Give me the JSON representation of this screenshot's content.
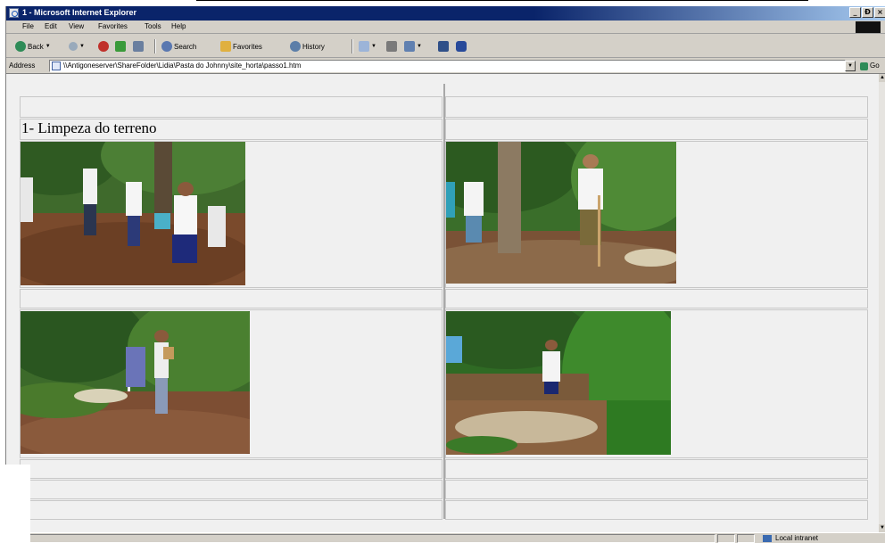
{
  "window": {
    "title": "1 - Microsoft Internet Explorer",
    "controls": [
      "_",
      "Ɖ",
      "×"
    ]
  },
  "menu": {
    "file": "File",
    "edit": "Edit",
    "view": "View",
    "favorites": "Favorites",
    "tools": "Tools",
    "help": "Help"
  },
  "toolbar": {
    "back": "Back",
    "search": "Search",
    "favorites": "Favorites",
    "history": "History"
  },
  "address": {
    "label": "Address",
    "url": "\\\\Antigoneserver\\ShareFolder\\Lidia\\Pasta do Johnny\\site_horta\\passo1.htm",
    "go": "Go"
  },
  "page": {
    "heading": "1- Limpeza do terreno",
    "photos": [
      {
        "description": "children clearing ground with rakes under trees"
      },
      {
        "description": "child with rake next to tree trunk"
      },
      {
        "description": "child raking soil beside bushes"
      },
      {
        "description": "child in shade of green trees"
      }
    ]
  },
  "status": {
    "zone": "Local intranet"
  },
  "colors": {
    "title_bar": "#0a246a",
    "chrome": "#d4d0c8",
    "page_bg": "#f0f0f0"
  }
}
